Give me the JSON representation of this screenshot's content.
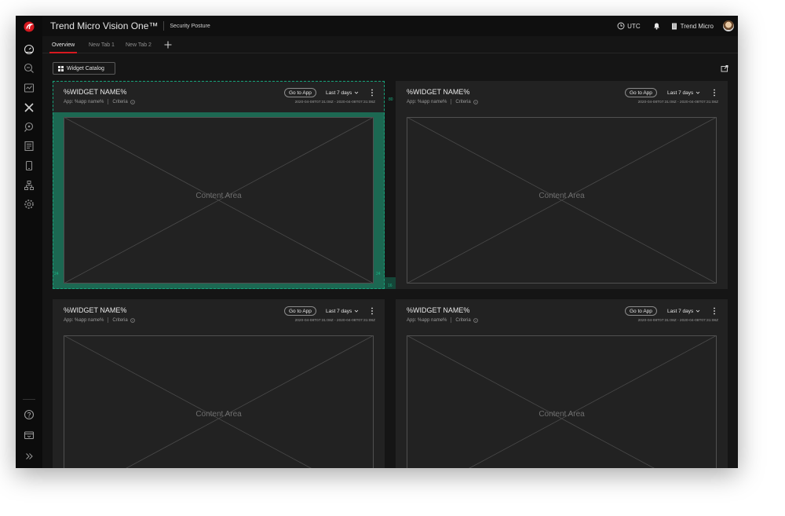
{
  "app": {
    "title": "Trend Micro Vision One™",
    "subtitle": "Security Posture"
  },
  "header": {
    "utc_label": "UTC",
    "user_label": "Trend Micro"
  },
  "tabs": [
    {
      "label": "Overview",
      "active": true
    },
    {
      "label": "New Tab 1",
      "active": false
    },
    {
      "label": "New Tab 2",
      "active": false
    }
  ],
  "toolbar": {
    "widget_catalog_label": "Widget Catalog"
  },
  "widgets": [
    {
      "title": "%WIDGET NAME%",
      "app_label": "App: %app name%",
      "criteria_label": "Criteria",
      "goto_label": "Go to App",
      "range_label": "Last 7 days",
      "date_range": "2020-04-08T07:31:08Z - 2020-04-08T07:31:08Z",
      "content_label": "Content Area"
    },
    {
      "title": "%WIDGET NAME%",
      "app_label": "App: %app name%",
      "criteria_label": "Criteria",
      "goto_label": "Go to App",
      "range_label": "Last 7 days",
      "date_range": "2020-04-08T07:31:08Z - 2020-04-08T07:31:08Z",
      "content_label": "Content Area"
    },
    {
      "title": "%WIDGET NAME%",
      "app_label": "App: %app name%",
      "criteria_label": "Criteria",
      "goto_label": "Go to App",
      "range_label": "Last 7 days",
      "date_range": "2020-04-08T07:31:08Z - 2020-04-08T07:31:08Z",
      "content_label": "Content Area"
    },
    {
      "title": "%WIDGET NAME%",
      "app_label": "App: %app name%",
      "criteria_label": "Criteria",
      "goto_label": "Go to App",
      "range_label": "Last 7 days",
      "date_range": "2020-04-08T07:31:08Z - 2020-04-08T07:31:08Z",
      "content_label": "Content Area"
    }
  ],
  "spacing_guides": {
    "header_height": "80",
    "left_padding": "24",
    "right_padding": "24",
    "gap": "16"
  },
  "rail_icons": {
    "top": [
      "trend-logo-icon",
      "dashboard-gauge-icon",
      "search-icon",
      "workbench-icon",
      "xdr-icon",
      "threat-hunting-icon",
      "reports-icon",
      "mobile-icon",
      "network-inventory-icon",
      "settings-gear-icon"
    ],
    "bottom": [
      "help-icon",
      "admin-console-icon",
      "expand-rail-icon"
    ]
  },
  "colors": {
    "brand_red": "#d71920",
    "guide_green": "#17a37a",
    "background": "#151515",
    "widget_bg": "#222222"
  }
}
